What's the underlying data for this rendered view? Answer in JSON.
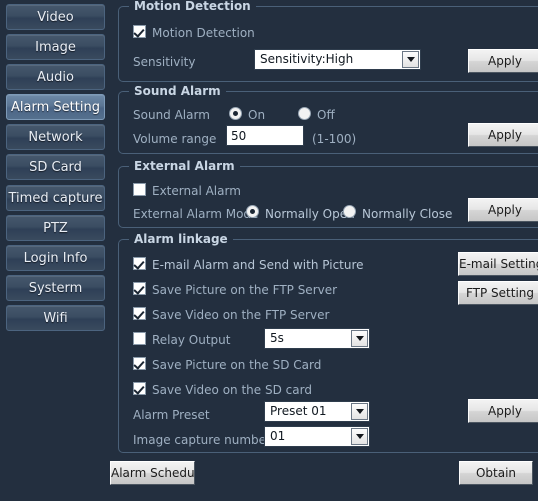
{
  "sidebar": {
    "items": [
      {
        "label": "Video",
        "selected": false
      },
      {
        "label": "Image",
        "selected": false
      },
      {
        "label": "Audio",
        "selected": false
      },
      {
        "label": "Alarm Setting",
        "selected": true
      },
      {
        "label": "Network",
        "selected": false
      },
      {
        "label": "SD Card",
        "selected": false
      },
      {
        "label": "Timed capture",
        "selected": false
      },
      {
        "label": "PTZ",
        "selected": false
      },
      {
        "label": "Login Info",
        "selected": false
      },
      {
        "label": "Systerm",
        "selected": false
      },
      {
        "label": "Wifi",
        "selected": false
      }
    ]
  },
  "motion_detection": {
    "legend": "Motion Detection",
    "checkbox_label": "Motion Detection",
    "checkbox_checked": true,
    "sensitivity_label": "Sensitivity",
    "sensitivity_value": "Sensitivity:High",
    "apply_label": "Apply"
  },
  "sound_alarm": {
    "legend": "Sound Alarm",
    "row_label": "Sound Alarm",
    "on_label": "On",
    "off_label": "Off",
    "selected": "On",
    "volume_label": "Volume range",
    "volume_value": "50",
    "volume_hint": "(1-100)",
    "apply_label": "Apply"
  },
  "external_alarm": {
    "legend": "External Alarm",
    "checkbox_label": "External Alarm",
    "checkbox_checked": false,
    "mode_label": "External Alarm Mode",
    "normally_open_label": "Normally Open",
    "normally_close_label": "Normally Close",
    "mode_selected": "Normally Open",
    "apply_label": "Apply"
  },
  "alarm_linkage": {
    "legend": "Alarm linkage",
    "email_alarm_label": "E-mail Alarm and Send with Picture",
    "email_alarm_checked": true,
    "email_setting_label": "E-mail Setting",
    "save_pic_ftp_label": "Save Picture on the FTP Server",
    "save_pic_ftp_checked": true,
    "ftp_setting_label": "FTP Setting",
    "save_vid_ftp_label": "Save Video on the FTP Server",
    "save_vid_ftp_checked": true,
    "relay_output_label": "Relay Output",
    "relay_output_checked": false,
    "relay_output_value": "5s",
    "save_pic_sd_label": "Save Picture on the SD Card",
    "save_pic_sd_checked": true,
    "save_vid_sd_label": "Save Video on the SD card",
    "save_vid_sd_checked": true,
    "alarm_preset_label": "Alarm Preset",
    "alarm_preset_value": "Preset 01",
    "image_capture_label": "Image capture number",
    "image_capture_value": "01",
    "apply_label": "Apply"
  },
  "footer": {
    "alarm_schedule_label": "Alarm Schedule",
    "obtain_label": "Obtain"
  },
  "colors": {
    "background": "#232f3f",
    "group_border": "#4a6078",
    "label_text": "#9fb0c2",
    "legend_text": "#c9d6e4",
    "nav_selected": "#5b7593"
  }
}
